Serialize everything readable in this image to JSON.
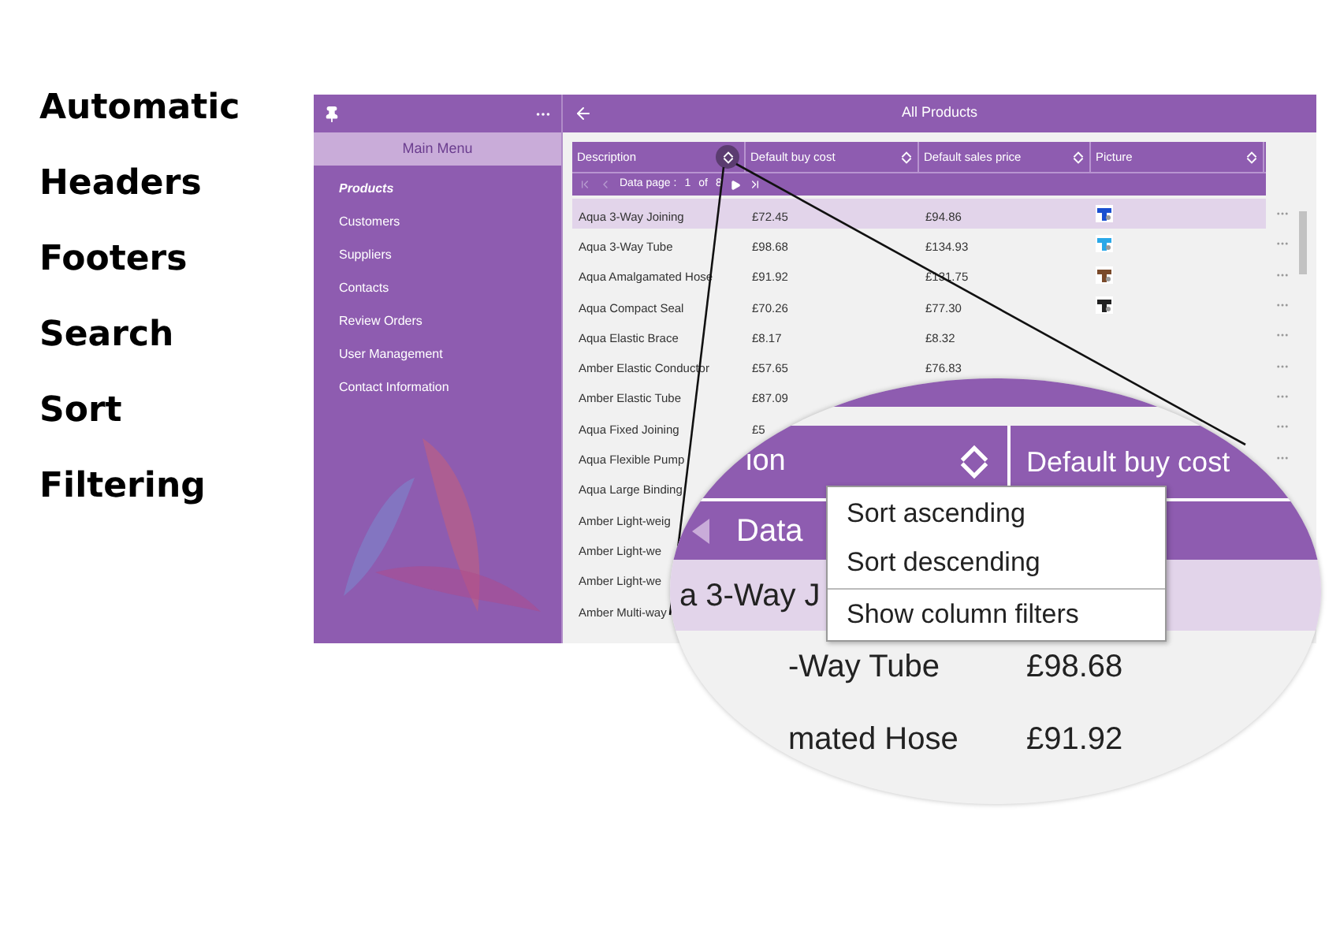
{
  "features": [
    "Automatic",
    "Headers",
    "Footers",
    "Search",
    "Sort",
    "Filtering"
  ],
  "sidebar": {
    "title": "Main Menu",
    "items": [
      {
        "label": "Products",
        "selected": true
      },
      {
        "label": "Customers",
        "selected": false
      },
      {
        "label": "Suppliers",
        "selected": false
      },
      {
        "label": "Contacts",
        "selected": false
      },
      {
        "label": "Review Orders",
        "selected": false
      },
      {
        "label": "User Management",
        "selected": false
      },
      {
        "label": "Contact Information",
        "selected": false
      }
    ]
  },
  "header": {
    "title": "All Products"
  },
  "grid": {
    "columns": [
      {
        "label": "Description"
      },
      {
        "label": "Default buy cost"
      },
      {
        "label": "Default sales price"
      },
      {
        "label": "Picture"
      }
    ],
    "pager": {
      "label": "Data page :",
      "page": "1",
      "of": "of",
      "total": "8"
    },
    "rows": [
      {
        "cells": [
          "Aqua 3-Way Joining",
          "£72.45",
          "£94.86"
        ],
        "picture": true,
        "menu_icon": true,
        "selected": true
      },
      {
        "cells": [
          "Aqua 3-Way Tube",
          "£98.68",
          "£134.93"
        ],
        "picture": true,
        "menu_icon": true,
        "selected": false
      },
      {
        "cells": [
          "Aqua Amalgamated Hose",
          "£91.92",
          "£131.75"
        ],
        "picture": true,
        "menu_icon": true,
        "selected": false
      },
      {
        "cells": [
          "Aqua Compact Seal",
          "£70.26",
          "£77.30"
        ],
        "picture": true,
        "menu_icon": true,
        "selected": false
      },
      {
        "cells": [
          "Aqua Elastic Brace",
          "£8.17",
          "£8.32"
        ],
        "picture": false,
        "menu_icon": true,
        "selected": false
      },
      {
        "cells": [
          "Amber Elastic Conductor",
          "£57.65",
          "£76.83"
        ],
        "picture": false,
        "menu_icon": true,
        "selected": false
      },
      {
        "cells": [
          "Amber Elastic Tube",
          "£87.09"
        ],
        "picture": false,
        "menu_icon": true,
        "selected": false
      },
      {
        "cells": [
          "Aqua Fixed Joining",
          "£5"
        ],
        "picture": false,
        "menu_icon": true,
        "selected": false
      },
      {
        "cells": [
          "Aqua Flexible Pump"
        ],
        "picture": false,
        "menu_icon": true,
        "selected": false
      },
      {
        "cells": [
          "Aqua Large Binding"
        ],
        "picture": false,
        "menu_icon": false,
        "selected": false
      },
      {
        "cells": [
          "Amber Light-weig"
        ],
        "picture": false,
        "menu_icon": false,
        "selected": false
      },
      {
        "cells": [
          "Amber Light-we"
        ],
        "picture": false,
        "menu_icon": false,
        "selected": false
      },
      {
        "cells": [
          "Amber Light-we"
        ],
        "picture": false,
        "menu_icon": false,
        "selected": false
      },
      {
        "cells": [
          "Amber Multi-way"
        ],
        "picture": false,
        "menu_icon": false,
        "selected": false
      }
    ]
  },
  "magnifier": {
    "columns": [
      {
        "label": "ion"
      },
      {
        "label": "Default buy cost"
      }
    ],
    "pager_label": "Data",
    "rows": [
      {
        "cells": [
          "a 3-Way J"
        ],
        "selected": true
      },
      {
        "cells": [
          "-Way Tube",
          "£98.68"
        ],
        "selected": false
      },
      {
        "cells": [
          "mated Hose",
          "£91.92"
        ],
        "selected": false
      }
    ],
    "context_menu": [
      {
        "label": "Sort ascending",
        "separator_before": false
      },
      {
        "label": "Sort descending",
        "separator_before": false
      },
      {
        "label": "Show column filters",
        "separator_before": true
      }
    ]
  }
}
